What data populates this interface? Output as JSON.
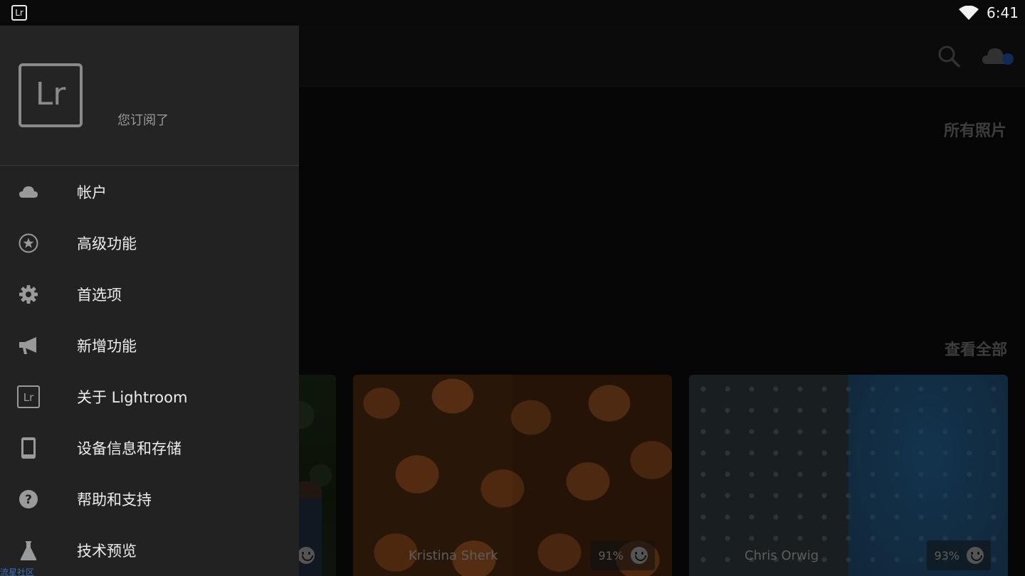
{
  "status_bar": {
    "app_icon_text": "Lr",
    "time": "6:41"
  },
  "toolbar": {
    "search_icon": "search-icon",
    "cloud_icon": "cloud-sync-icon"
  },
  "main": {
    "section_title": "所有照片",
    "view_all": "查看全部",
    "cards": [
      {
        "caption": "Kristina Sherk",
        "score": "91%"
      },
      {
        "caption": "Chris Orwig",
        "score": "93%"
      }
    ]
  },
  "drawer": {
    "logo_text": "Lr",
    "subtitle": "您订阅了",
    "items": [
      {
        "label": "帐户",
        "icon": "cloud-icon"
      },
      {
        "label": "高级功能",
        "icon": "star-circle-icon"
      },
      {
        "label": "首选项",
        "icon": "gear-icon"
      },
      {
        "label": "新增功能",
        "icon": "megaphone-icon"
      },
      {
        "label": "关于 Lightroom",
        "icon": "lr-icon"
      },
      {
        "label": "设备信息和存储",
        "icon": "phone-icon"
      },
      {
        "label": "帮助和支持",
        "icon": "help-icon"
      },
      {
        "label": "技术预览",
        "icon": "flask-icon"
      }
    ]
  },
  "watermark": "流星社区"
}
